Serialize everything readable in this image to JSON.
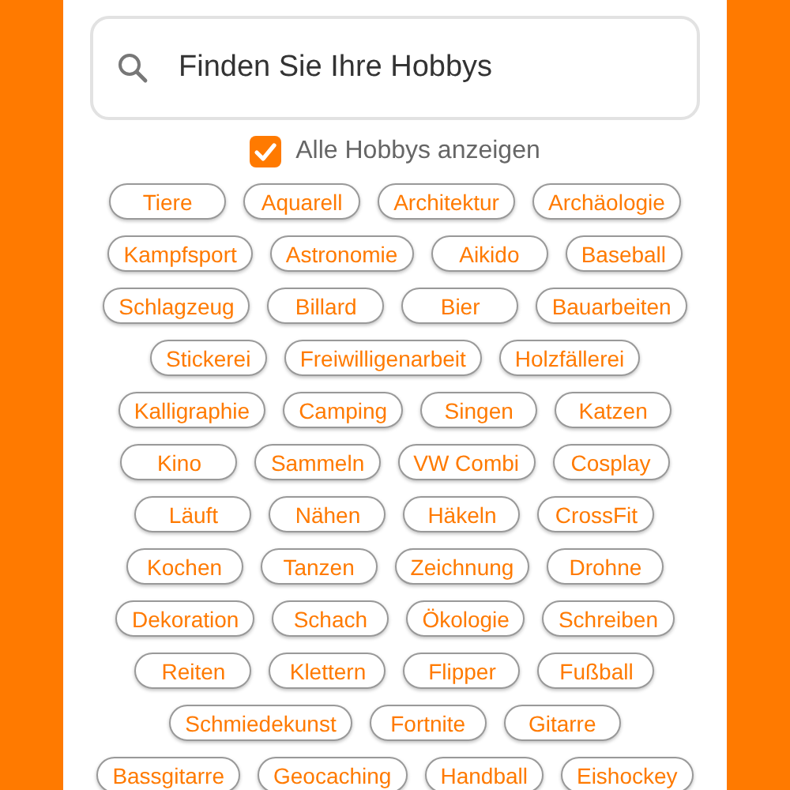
{
  "search": {
    "placeholder": "Finden Sie Ihre Hobbys"
  },
  "show_all": {
    "label": "Alle Hobbys anzeigen",
    "checked": true
  },
  "hobby_rows": [
    [
      "Tiere",
      "Aquarell",
      "Architektur",
      "Archäologie"
    ],
    [
      "Kampfsport",
      "Astronomie",
      "Aikido",
      "Baseball"
    ],
    [
      "Schlagzeug",
      "Billard",
      "Bier",
      "Bauarbeiten"
    ],
    [
      "Stickerei",
      "Freiwilligenarbeit",
      "Holzfällerei"
    ],
    [
      "Kalligraphie",
      "Camping",
      "Singen",
      "Katzen"
    ],
    [
      "Kino",
      "Sammeln",
      "VW Combi",
      "Cosplay"
    ],
    [
      "Läuft",
      "Nähen",
      "Häkeln",
      "CrossFit"
    ],
    [
      "Kochen",
      "Tanzen",
      "Zeichnung",
      "Drohne"
    ],
    [
      "Dekoration",
      "Schach",
      "Ökologie",
      "Schreiben"
    ],
    [
      "Reiten",
      "Klettern",
      "Flipper",
      "Fußball"
    ],
    [
      "Schmiedekunst",
      "Fortnite",
      "Gitarre"
    ],
    [
      "Bassgitarre",
      "Geocaching",
      "Handball",
      "Eishockey"
    ]
  ]
}
